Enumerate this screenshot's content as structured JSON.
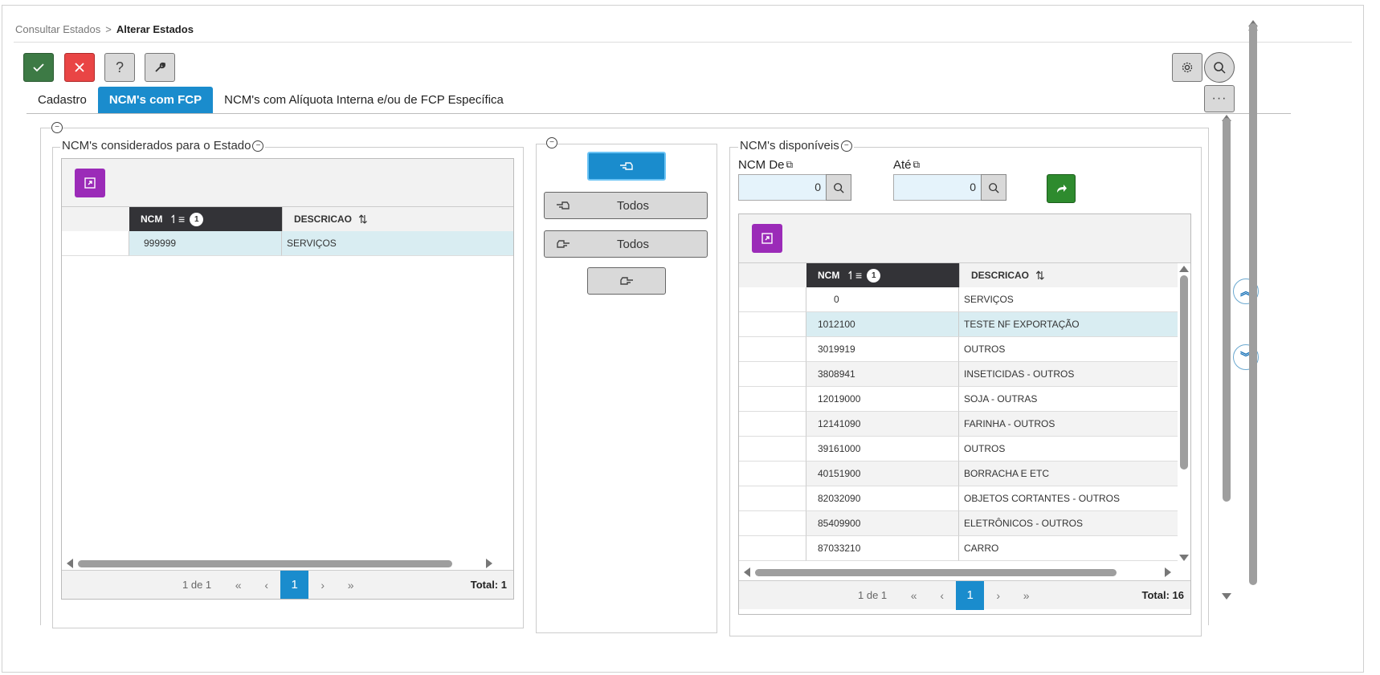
{
  "breadcrumb": {
    "parent": "Consultar Estados",
    "separator": ">",
    "current": "Alterar Estados"
  },
  "toolbar": {
    "confirm_icon": "check-icon",
    "cancel_icon": "close-icon",
    "help_label": "?",
    "tools_icon": "wrench-icon"
  },
  "tabs": [
    {
      "label": "Cadastro",
      "active": false
    },
    {
      "label": "NCM's com FCP",
      "active": true
    },
    {
      "label": "NCM's com Alíquota Interna e/ou de FCP Específica",
      "active": false
    }
  ],
  "left_panel": {
    "title": "NCM's considerados para o Estado",
    "columns": {
      "ncm": "NCM",
      "descricao": "DESCRICAO",
      "sort_badge": "1"
    },
    "rows": [
      {
        "ncm": "999999",
        "descricao": "SERVIÇOS"
      }
    ],
    "pager": {
      "page_info": "1 de 1",
      "current_page": "1",
      "total_label": "Total:",
      "total": "1"
    }
  },
  "middle_panel": {
    "all_left_label": "Todos",
    "all_right_label": "Todos"
  },
  "right_panel": {
    "title": "NCM's disponíveis",
    "filter": {
      "from_label": "NCM De",
      "from_value": "0",
      "to_label": "Até",
      "to_value": "0"
    },
    "columns": {
      "ncm": "NCM",
      "descricao": "DESCRICAO",
      "sort_badge": "1"
    },
    "rows": [
      {
        "ncm": "0",
        "descricao": "SERVIÇOS"
      },
      {
        "ncm": "1012100",
        "descricao": "TESTE NF EXPORTAÇÃO"
      },
      {
        "ncm": "3019919",
        "descricao": "OUTROS"
      },
      {
        "ncm": "3808941",
        "descricao": "INSETICIDAS - OUTROS"
      },
      {
        "ncm": "12019000",
        "descricao": "SOJA - OUTRAS"
      },
      {
        "ncm": "12141090",
        "descricao": "FARINHA - OUTROS"
      },
      {
        "ncm": "39161000",
        "descricao": "OUTROS"
      },
      {
        "ncm": "40151900",
        "descricao": "BORRACHA E ETC"
      },
      {
        "ncm": "82032090",
        "descricao": "OBJETOS CORTANTES - OUTROS"
      },
      {
        "ncm": "85409900",
        "descricao": "ELETRÔNICOS - OUTROS"
      },
      {
        "ncm": "87033210",
        "descricao": "CARRO"
      }
    ],
    "pager": {
      "page_info": "1 de 1",
      "current_page": "1",
      "total_label": "Total:",
      "total": "16"
    }
  },
  "pager_symbols": {
    "first": "«",
    "prev": "‹",
    "next": "›",
    "last": "»"
  },
  "colors": {
    "primary": "#1a8ccd",
    "confirm": "#3d7a45",
    "cancel": "#e94545",
    "purple": "#9b2bb8",
    "green": "#2e8b2e",
    "header_dark": "#333337",
    "selected_row": "#d9edf2"
  }
}
